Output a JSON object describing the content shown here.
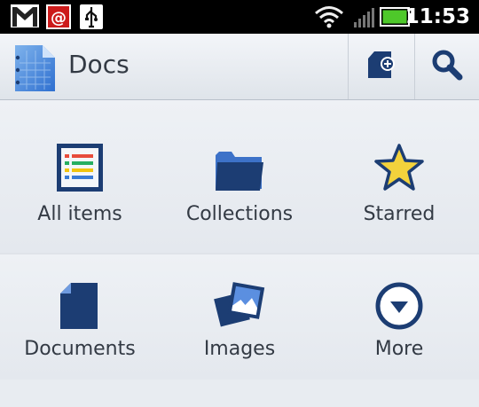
{
  "status_bar": {
    "time": "11:53",
    "icons": [
      "gmail-icon",
      "email-icon",
      "usb-icon",
      "wifi-icon",
      "signal-icon",
      "battery-icon"
    ]
  },
  "app_bar": {
    "title": "Docs",
    "actions": [
      "new-document-icon",
      "search-icon"
    ]
  },
  "tiles": [
    {
      "label": "All items",
      "icon": "list-icon"
    },
    {
      "label": "Collections",
      "icon": "folder-icon"
    },
    {
      "label": "Starred",
      "icon": "star-icon"
    },
    {
      "label": "Documents",
      "icon": "document-icon"
    },
    {
      "label": "Images",
      "icon": "images-icon"
    },
    {
      "label": "More",
      "icon": "more-icon"
    }
  ],
  "colors": {
    "accent_blue": "#1c3d73",
    "star_yellow": "#f3d23c",
    "battery_green": "#4ec82a"
  }
}
